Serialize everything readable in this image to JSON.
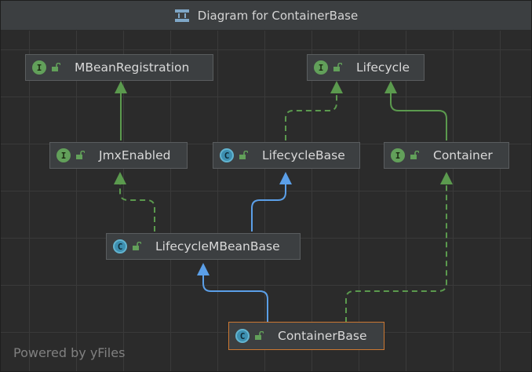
{
  "window": {
    "title": "Diagram for ContainerBase"
  },
  "footer": {
    "powered_by": "Powered by yFiles"
  },
  "nodes": {
    "mbean": {
      "label": "MBeanRegistration",
      "kind": "interface",
      "badge": "I"
    },
    "lifecycle": {
      "label": "Lifecycle",
      "kind": "interface",
      "badge": "I"
    },
    "jmx": {
      "label": "JmxEnabled",
      "kind": "interface",
      "badge": "I"
    },
    "lifecyclebase": {
      "label": "LifecycleBase",
      "kind": "class",
      "badge": "C"
    },
    "container": {
      "label": "Container",
      "kind": "interface",
      "badge": "I"
    },
    "lmbb": {
      "label": "LifecycleMBeanBase",
      "kind": "class",
      "badge": "C"
    },
    "containerbase": {
      "label": "ContainerBase",
      "kind": "class",
      "badge": "C",
      "selected": true
    }
  },
  "colors": {
    "interface_badge": "#62a05a",
    "class_badge": "#3d8fb0",
    "extends_edge": "#5b9fe8",
    "implements_edge": "#5b9a4e",
    "selection": "#cc7832"
  }
}
